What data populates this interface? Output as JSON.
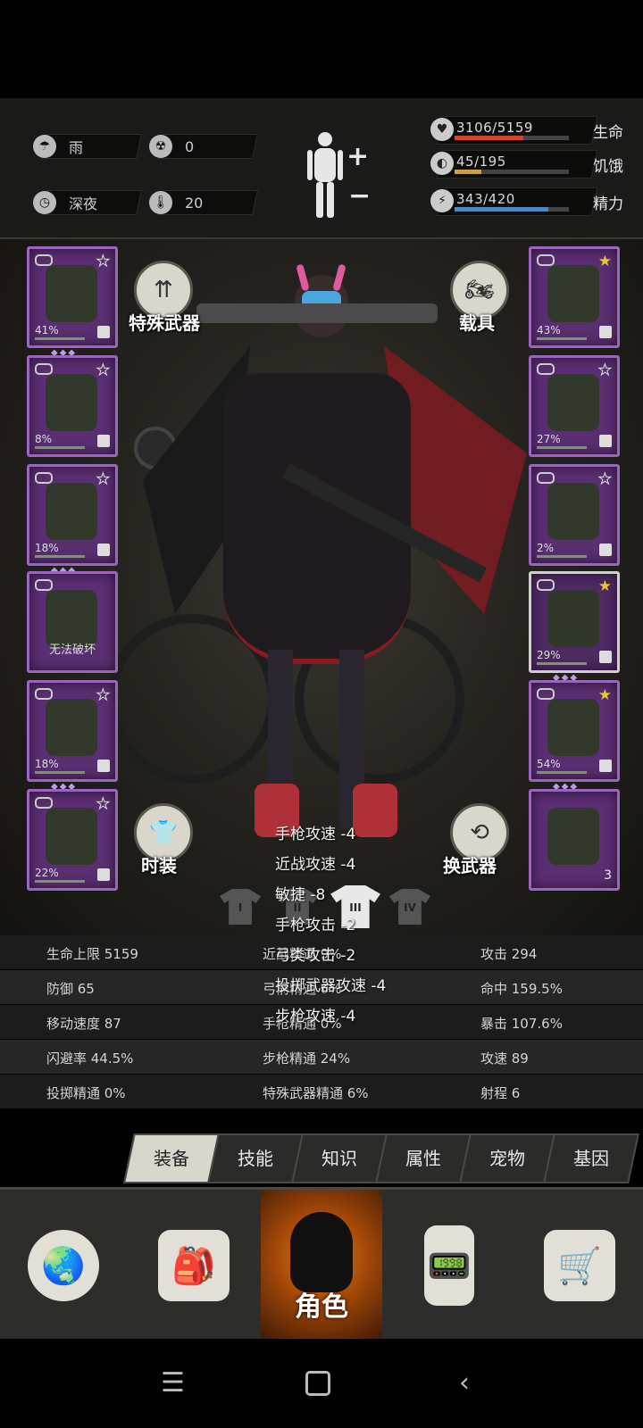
{
  "status": {
    "weather": {
      "icon": "rain-cloud-icon",
      "label": "雨"
    },
    "radiation": {
      "icon": "radiation-icon",
      "value": "0"
    },
    "time": {
      "icon": "clock-icon",
      "label": "深夜"
    },
    "temperature": {
      "icon": "thermometer-icon",
      "value": "20"
    },
    "bars": [
      {
        "name": "health",
        "text": "3106/5159",
        "label": "生命",
        "fraction": 0.602,
        "color": "#d4442e",
        "icon": "heart-icon"
      },
      {
        "name": "hunger",
        "text": "45/195",
        "label": "饥饿",
        "fraction": 0.231,
        "color": "#caa04a",
        "icon": "stomach-icon"
      },
      {
        "name": "energy",
        "text": "343/420",
        "label": "精力",
        "fraction": 0.817,
        "color": "#4f86c6",
        "icon": "energy-bolt-icon"
      }
    ]
  },
  "left_slots": [
    {
      "name": "helmet",
      "pct": "41%",
      "gems": "◆◆◆",
      "star": "empty"
    },
    {
      "name": "shirt",
      "pct": "8%",
      "gems": "",
      "star": "empty"
    },
    {
      "name": "jacket",
      "pct": "18%",
      "gems": "◆◆◆",
      "star": "empty"
    },
    {
      "name": "backpack",
      "center_text": "无法破坏",
      "star": "none"
    },
    {
      "name": "pants",
      "pct": "18%",
      "gems": "◆◆◆",
      "star": "empty"
    },
    {
      "name": "boots",
      "pct": "22%",
      "gems": "",
      "star": "empty"
    }
  ],
  "right_slots": [
    {
      "name": "goggles",
      "pct": "43%",
      "star": "filled"
    },
    {
      "name": "gas-mask",
      "pct": "27%",
      "star": "empty"
    },
    {
      "name": "vest",
      "pct": "2%",
      "star": "empty"
    },
    {
      "name": "rifle",
      "pct": "29%",
      "gems": "◆◆◆",
      "star": "filled",
      "selected": true
    },
    {
      "name": "machete",
      "pct": "54%",
      "gems": "◆◆◆",
      "star": "filled"
    },
    {
      "name": "explosive",
      "count": "3",
      "star": "none"
    }
  ],
  "buttons": {
    "special_weapon": "特殊武器",
    "vehicle": "载具",
    "fashion": "时装",
    "swap_weapon": "换武器"
  },
  "outfit_sets": [
    "I",
    "II",
    "III",
    "IV"
  ],
  "modifiers": [
    "手枪攻速 -4",
    "近战攻速 -4",
    "敏捷 -8",
    "手枪攻击 -2",
    "弓类攻击 -2",
    "投掷武器攻速 -4",
    "步枪攻速 -4"
  ],
  "stats": [
    [
      "生命上限 5159",
      "近战精通 9%",
      "攻击 294"
    ],
    [
      "防御 65",
      "弓箭精通 0%",
      "命中 159.5%"
    ],
    [
      "移动速度 87",
      "手枪精通 0%",
      "暴击 107.6%"
    ],
    [
      "闪避率 44.5%",
      "步枪精通 24%",
      "攻速 89"
    ],
    [
      "投掷精通 0%",
      "特殊武器精通 6%",
      "射程 6"
    ]
  ],
  "tabs": [
    "装备",
    "技能",
    "知识",
    "属性",
    "宠物",
    "基因"
  ],
  "bottom_nav": {
    "map": "globe-icon",
    "inventory": "backpack-icon",
    "character": "角色",
    "radio": "walkie-talkie-icon",
    "shop": "cart-icon"
  }
}
